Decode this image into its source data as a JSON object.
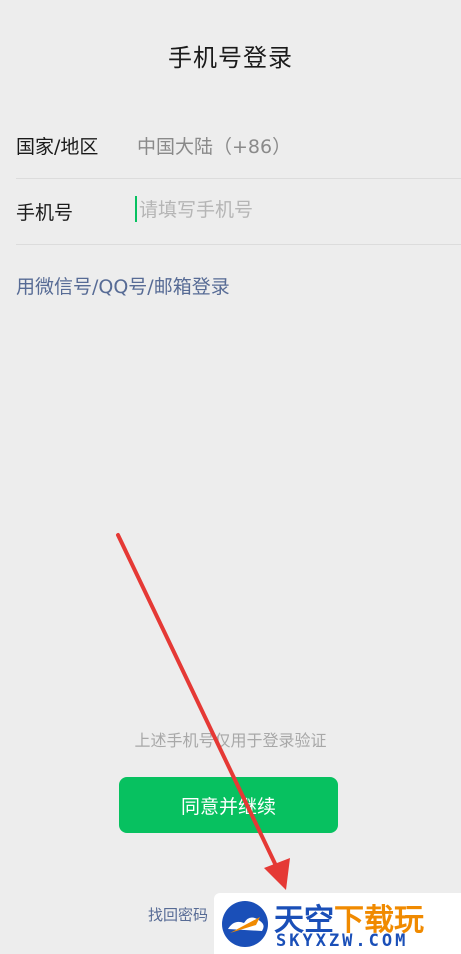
{
  "header": {
    "title": "手机号登录"
  },
  "form": {
    "country_label": "国家/地区",
    "country_value": "中国大陆（+86）",
    "phone_label": "手机号",
    "phone_placeholder": "请填写手机号",
    "phone_value": ""
  },
  "alt_login": {
    "label": "用微信号/QQ号/邮箱登录"
  },
  "footer": {
    "notice": "上述手机号仅用于登录验证",
    "agree_button": "同意并继续",
    "find_password": "找回密码"
  },
  "watermark": {
    "name_main": "天空",
    "name_accent": "下载玩",
    "domain": "SKYXZW.COM",
    "logo_icon": "cloud-plane-logo"
  },
  "annotation": {
    "arrow_color": "#e53935"
  },
  "colors": {
    "background": "#ededed",
    "accent_green": "#07c160",
    "link_blue": "#576b95"
  }
}
